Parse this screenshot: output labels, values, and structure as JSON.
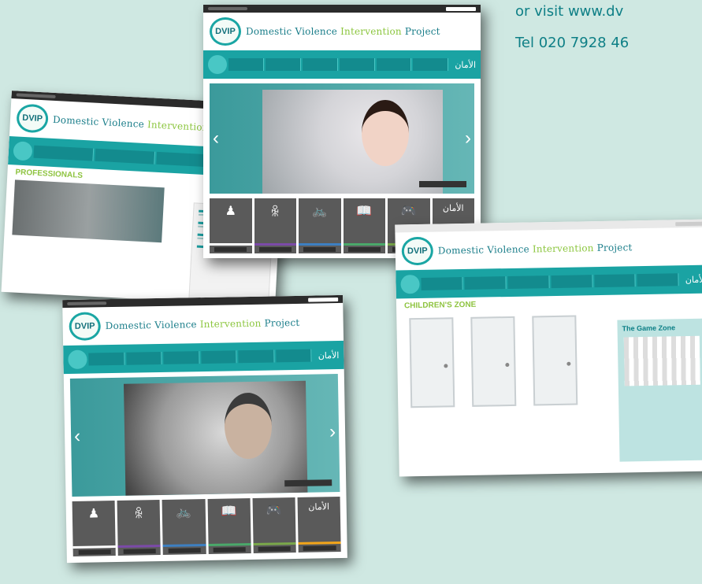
{
  "contact": {
    "visit_text": "or visit www.dv",
    "tel_text": "Tel 020 7928 46"
  },
  "site": {
    "logo_text": "DVIP",
    "name_part1": "Domestic Violence ",
    "name_part2": "Intervention ",
    "name_part3": "Project",
    "arabic_nav": "الأمان"
  },
  "pages": {
    "professionals_title": "PROFESSIONALS",
    "childrens_zone_title": "CHILDREN'S ZONE",
    "game_zone_title": "The Game Zone"
  },
  "tiles": {
    "icons": [
      "♟",
      "ꆜ",
      "🚲",
      "📖",
      "🎮",
      "الأمان"
    ],
    "colors": [
      "#ffffff",
      "#7b4aa8",
      "#3d7fc1",
      "#4aa86a",
      "#7aa84a",
      "#f2a51a"
    ]
  }
}
